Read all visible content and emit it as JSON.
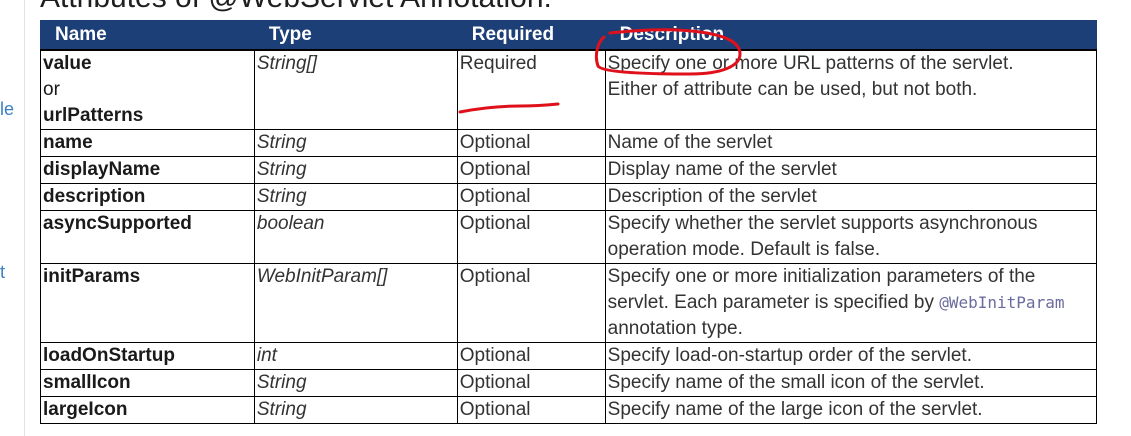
{
  "heading": "Attributes of @WebServlet Annotation:",
  "gutter": {
    "text1": "le",
    "text2": "t"
  },
  "table": {
    "headers": [
      "Name",
      "Type",
      "Required",
      "Description"
    ],
    "first_row": {
      "name_parts": [
        "value",
        "or",
        "urlPatterns"
      ],
      "type": "String[]",
      "required": "Required",
      "description_lines": [
        "Specify one or more URL patterns of the servlet.",
        "Either of attribute can be used, but not both."
      ]
    },
    "rows": [
      {
        "name": "name",
        "type": "String",
        "required": "Optional",
        "description": "Name of the servlet"
      },
      {
        "name": "displayName",
        "type": "String",
        "required": "Optional",
        "description": "Display name of the servlet"
      },
      {
        "name": "description",
        "type": "String",
        "required": "Optional",
        "description": "Description of the servlet"
      },
      {
        "name": "asyncSupported",
        "type": "boolean",
        "required": "Optional",
        "description": "Specify whether the servlet supports asynchronous operation mode. Default is false."
      },
      {
        "name": "initParams",
        "type": "WebInitParam[]",
        "required": "Optional",
        "description_prefix": "Specify one or more initialization parameters of the servlet. Each parameter is specified by ",
        "description_code": "@WebInitParam",
        "description_suffix": " annotation type."
      },
      {
        "name": "loadOnStartup",
        "type": "int",
        "required": "Optional",
        "description": "Specify load-on-startup order of the servlet."
      },
      {
        "name": "smallIcon",
        "type": "String",
        "required": "Optional",
        "description": "Specify name of the small icon of the servlet."
      },
      {
        "name": "largeIcon",
        "type": "String",
        "required": "Optional",
        "description": "Specify name of the large icon of the servlet."
      }
    ]
  },
  "colors": {
    "header_bg": "#1c3f77",
    "annotation": "#e0101a",
    "link": "#3b7fc4"
  }
}
